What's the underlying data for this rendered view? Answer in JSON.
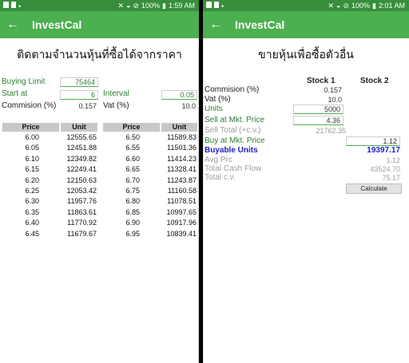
{
  "left": {
    "status": {
      "battery": "100%",
      "time": "1:59 AM"
    },
    "app_title": "InvestCal",
    "page_title": "ติดตามจำนวนหุ้นที่ซื้อได้จากราคา",
    "buying_limit": {
      "label": "Buying Limit",
      "value": "75464"
    },
    "start_at": {
      "label": "Start at",
      "value": "6"
    },
    "interval": {
      "label": "Interval",
      "value": "0.05"
    },
    "commission": {
      "label": "Commision (%)",
      "value": "0.157"
    },
    "vat": {
      "label": "Vat (%)",
      "value": "10.0"
    },
    "table": {
      "headers": [
        "Price",
        "Unit",
        "Price",
        "Unit"
      ],
      "rows": [
        [
          "6.00",
          "12555.65",
          "6.50",
          "11589.83"
        ],
        [
          "6.05",
          "12451.88",
          "6.55",
          "11501.36"
        ],
        [
          "6.10",
          "12349.82",
          "6.60",
          "11414.23"
        ],
        [
          "6.15",
          "12249.41",
          "6.65",
          "11328.41"
        ],
        [
          "6.20",
          "12150.63",
          "6.70",
          "11243.87"
        ],
        [
          "6.25",
          "12053.42",
          "6.75",
          "11160.58"
        ],
        [
          "6.30",
          "11957.76",
          "6.80",
          "11078.51"
        ],
        [
          "6.35",
          "11863.61",
          "6.85",
          "10997.65"
        ],
        [
          "6.40",
          "11770.92",
          "6.90",
          "10917.96"
        ],
        [
          "6.45",
          "11679.67",
          "6.95",
          "10839.41"
        ]
      ]
    }
  },
  "right": {
    "status": {
      "battery": "100%",
      "time": "2:01 AM"
    },
    "app_title": "InvestCal",
    "page_title": "ขายหุ้นเพื่อซื้อตัวอื่น",
    "stock1_header": "Stock 1",
    "stock2_header": "Stock 2",
    "commission": {
      "label": "Commision (%)",
      "value": "0.157"
    },
    "vat": {
      "label": "Vat (%)",
      "value": "10.0"
    },
    "units": {
      "label": "Units",
      "value": "5000"
    },
    "sell_price": {
      "label": "Sell at Mkt. Price",
      "value": "4.36"
    },
    "sell_total": {
      "label": "Sell Total (+c.v.)",
      "value": "21762.35"
    },
    "buy_price": {
      "label": "Buy at Mkt. Price",
      "value": "1.12"
    },
    "buyable_units": {
      "label": "Buyable Units",
      "value": "19397.17"
    },
    "avg_prc": {
      "label": "Avg.Prc",
      "value": "1.12"
    },
    "total_cash_flow": {
      "label": "Total Cash Flow",
      "value": "43524.70"
    },
    "total_cv": {
      "label": "Total c.v.",
      "value": "75.17"
    },
    "calculate_label": "Calculate"
  }
}
